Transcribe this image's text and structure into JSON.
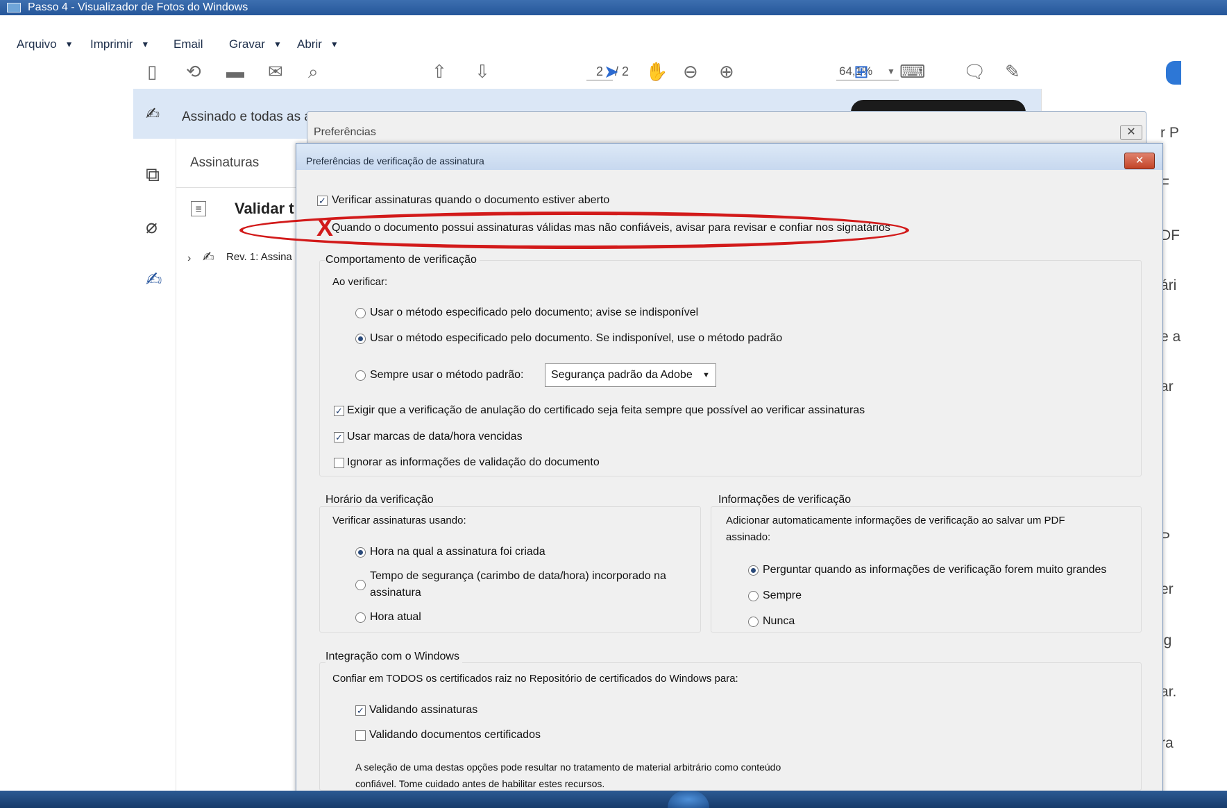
{
  "window": {
    "title": "Passo 4 - Visualizador de Fotos do Windows"
  },
  "menubar": {
    "items": [
      {
        "label": "Arquivo",
        "caret": "▼"
      },
      {
        "label": "Imprimir",
        "caret": "▼"
      },
      {
        "label": "Email"
      },
      {
        "label": "Gravar",
        "caret": "▼"
      },
      {
        "label": "Abrir",
        "caret": "▼"
      }
    ]
  },
  "toolbar": {
    "page_current": "2",
    "page_total": "/ 2",
    "zoom": "64,1%",
    "zoom_caret": "▼"
  },
  "signbar": {
    "text": "Assinado e todas as a"
  },
  "sig_panel": {
    "title": "Assinaturas",
    "validate": "Validar t",
    "revision": "Rev. 1: Assina"
  },
  "right_fragments": [
    "r P",
    "F",
    "DF",
    "ári",
    "e a",
    "ar",
    "P",
    "er",
    "ig",
    "ar.",
    "ra"
  ],
  "pref_dialog": {
    "title": "Preferências",
    "close": "✕"
  },
  "dialog": {
    "title": "Preferências de verificação de assinatura",
    "close": "✕",
    "verify_on_open": {
      "label": "Verificar assinaturas quando o documento estiver aberto",
      "checked": true
    },
    "warn_untrusted": {
      "label": "Quando o documento possui assinaturas válidas mas não confiáveis, avisar para revisar e confiar nos signatários",
      "mark": "X"
    },
    "behavior": {
      "legend": "Comportamento de verificação",
      "when_verifying": "Ao verificar:",
      "options": [
        {
          "label": "Usar o método especificado pelo documento; avise se indisponível",
          "selected": false
        },
        {
          "label": "Usar o método especificado pelo documento. Se indisponível, use o método padrão",
          "selected": true
        },
        {
          "label": "Sempre usar o método padrão:",
          "selected": false
        }
      ],
      "default_method": "Segurança padrão da Adobe",
      "checks": [
        {
          "label": "Exigir que a verificação de anulação do certificado seja feita sempre que possível ao verificar assinaturas",
          "checked": true
        },
        {
          "label": "Usar marcas de data/hora vencidas",
          "checked": true
        },
        {
          "label": "Ignorar as informações de validação do documento",
          "checked": false
        }
      ]
    },
    "time": {
      "legend": "Horário da verificação",
      "subtitle": "Verificar assinaturas usando:",
      "options": [
        {
          "label": "Hora na qual a assinatura foi criada",
          "selected": true
        },
        {
          "label_line1": "Tempo de segurança (carimbo de data/hora) incorporado na",
          "label_line2": "assinatura",
          "selected": false
        },
        {
          "label": "Hora atual",
          "selected": false
        }
      ]
    },
    "info": {
      "legend": "Informações de verificação",
      "subtitle_line1": "Adicionar automaticamente informações de verificação ao salvar um PDF",
      "subtitle_line2": "assinado:",
      "options": [
        {
          "label": "Perguntar quando as informações de verificação forem muito grandes",
          "selected": true
        },
        {
          "label": "Sempre",
          "selected": false
        },
        {
          "label": "Nunca",
          "selected": false
        }
      ]
    },
    "windows": {
      "legend": "Integração com o Windows",
      "subtitle": "Confiar em TODOS os certificados raiz no Repositório de certificados do Windows para:",
      "checks": [
        {
          "label": "Validando assinaturas",
          "checked": true
        },
        {
          "label": "Validando documentos certificados",
          "checked": false
        }
      ],
      "note_line1": "A seleção de uma destas opções pode resultar no tratamento de material arbitrário como conteúdo",
      "note_line2": "confiável. Tome cuidado antes de habilitar estes recursos."
    }
  },
  "colors": {
    "annotation_red": "#d21a1a",
    "signbar_blue": "#dbe7f6",
    "titlebar_blue": "#2f62a6"
  },
  "icons": {
    "check": "✓",
    "select_caret": "▼"
  }
}
